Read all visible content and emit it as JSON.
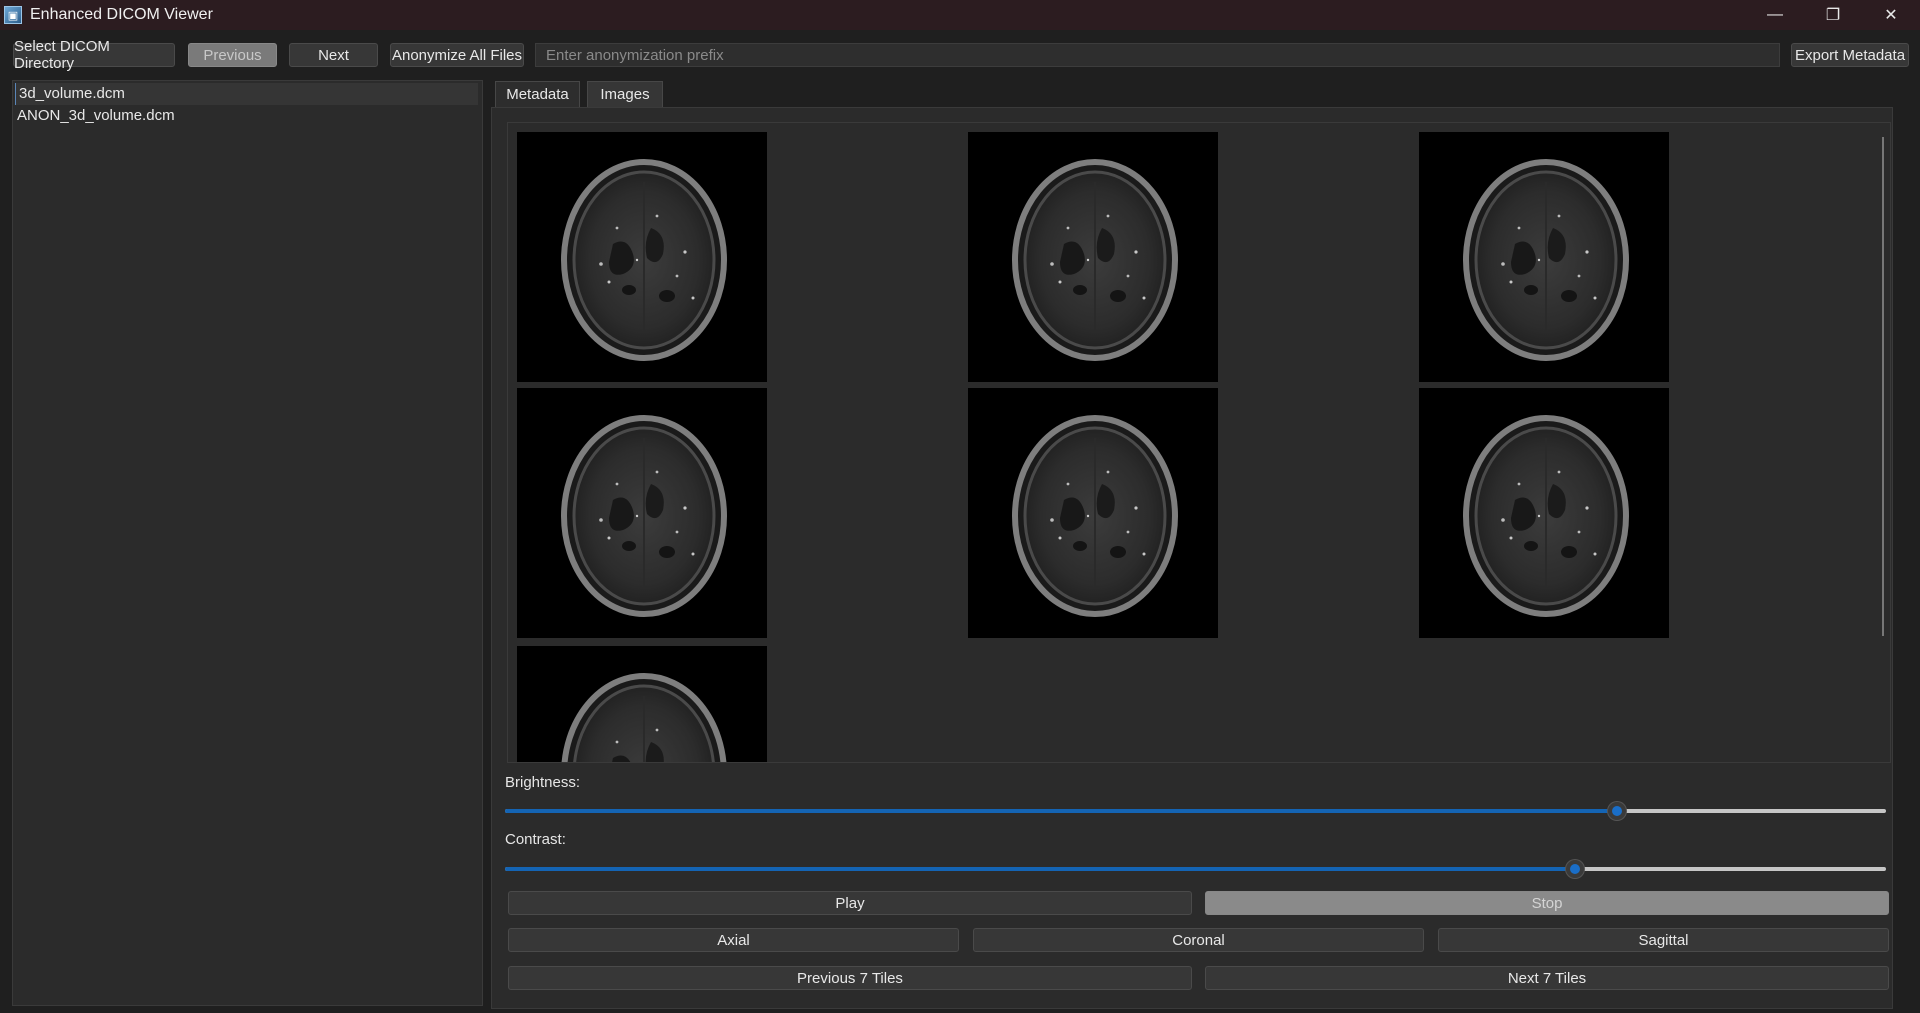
{
  "window": {
    "title": "Enhanced DICOM Viewer"
  },
  "toolbar": {
    "select_dir": "Select DICOM Directory",
    "previous": "Previous",
    "next": "Next",
    "anonymize": "Anonymize All Files",
    "prefix_placeholder": "Enter anonymization prefix",
    "export": "Export Metadata"
  },
  "files": [
    "3d_volume.dcm",
    "ANON_3d_volume.dcm"
  ],
  "tabs": {
    "metadata": "Metadata",
    "images": "Images"
  },
  "controls": {
    "brightness_label": "Brightness:",
    "brightness_value": 0.805,
    "contrast_label": "Contrast:",
    "contrast_value": 0.775,
    "play": "Play",
    "stop": "Stop",
    "axial": "Axial",
    "coronal": "Coronal",
    "sagittal": "Sagittal",
    "prev_tiles": "Previous 7 Tiles",
    "next_tiles": "Next 7 Tiles"
  },
  "colors": {
    "accent": "#1464b4",
    "titlebar": "#2c1c20",
    "background": "#1f1f1f"
  },
  "icons": {
    "app": "dicom-app-icon",
    "minimize": "minimize-icon",
    "maximize": "restore-icon",
    "close": "close-icon"
  }
}
